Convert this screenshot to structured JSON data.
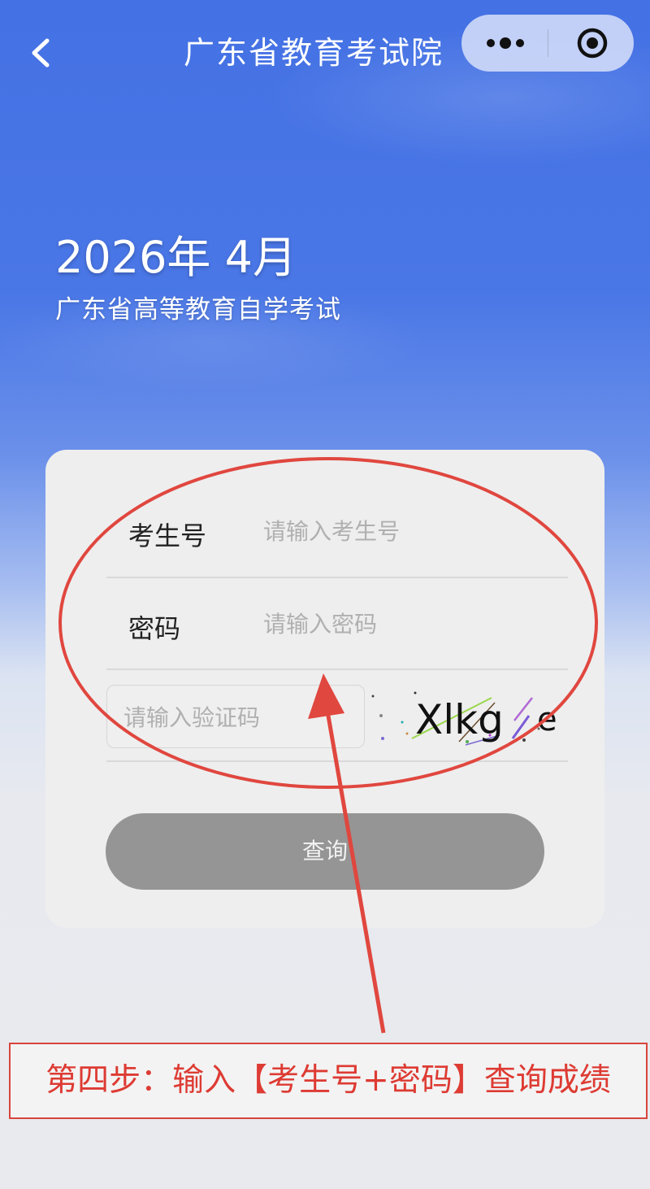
{
  "nav": {
    "title": "广东省教育考试院",
    "back_icon": "chevron-left-icon",
    "more_icon": "more-dots-icon",
    "close_icon": "target-close-icon"
  },
  "hero": {
    "year_month": "2026年 4月",
    "subtitle": "广东省高等教育自学考试"
  },
  "form": {
    "exam_id": {
      "label": "考生号",
      "placeholder": "请输入考生号",
      "value": ""
    },
    "password": {
      "label": "密码",
      "placeholder": "请输入密码",
      "value": ""
    },
    "captcha": {
      "placeholder": "请输入验证码",
      "value": "",
      "image_text": "Xlkg",
      "image_trailing": "e"
    },
    "submit_label": "查询"
  },
  "annotation": {
    "step_text": "第四步：输入【考生号+密码】查询成绩",
    "color": "#dd3b33"
  },
  "colors": {
    "header_blue": "#4471e4",
    "button_gray": "#959595"
  }
}
